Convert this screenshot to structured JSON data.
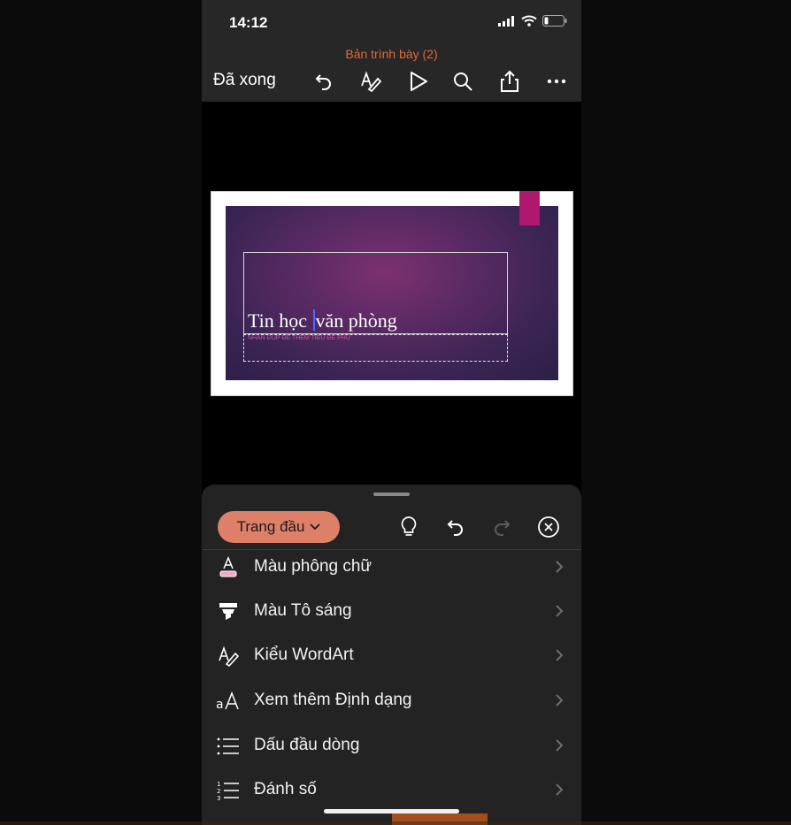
{
  "status": {
    "time": "14:12"
  },
  "header": {
    "title": "Bản trình bày (2)",
    "done_label": "Đã xong",
    "tools": [
      "undo-icon",
      "pen-icon",
      "play-icon",
      "search-icon",
      "share-icon",
      "more-icon"
    ]
  },
  "slide": {
    "title_before": "Tin học",
    "title_after": "văn phòng",
    "subtitle_placeholder": "NHẤN ĐÚP ĐỂ THÊM TIÊU ĐỀ PHỤ"
  },
  "ribbon": {
    "tab_label": "Trang đầu",
    "tools": [
      "lightbulb-icon",
      "undo-icon",
      "redo-icon",
      "close-circle-icon"
    ]
  },
  "menu": [
    {
      "label": "Màu phông chữ",
      "icon": "font-color-icon"
    },
    {
      "label": "Màu Tô sáng",
      "icon": "highlight-icon"
    },
    {
      "label": "Kiểu WordArt",
      "icon": "wordart-icon"
    },
    {
      "label": "Xem thêm Định dạng",
      "icon": "more-formatting-icon"
    },
    {
      "label": "Dấu đầu dòng",
      "icon": "bullets-icon"
    },
    {
      "label": "Đánh số",
      "icon": "numbering-icon"
    }
  ],
  "colors": {
    "accent": "#e0683b",
    "tab_button": "#de8068",
    "slide_tab": "#b01870",
    "font_color_swatch": "#f3a6c8"
  }
}
